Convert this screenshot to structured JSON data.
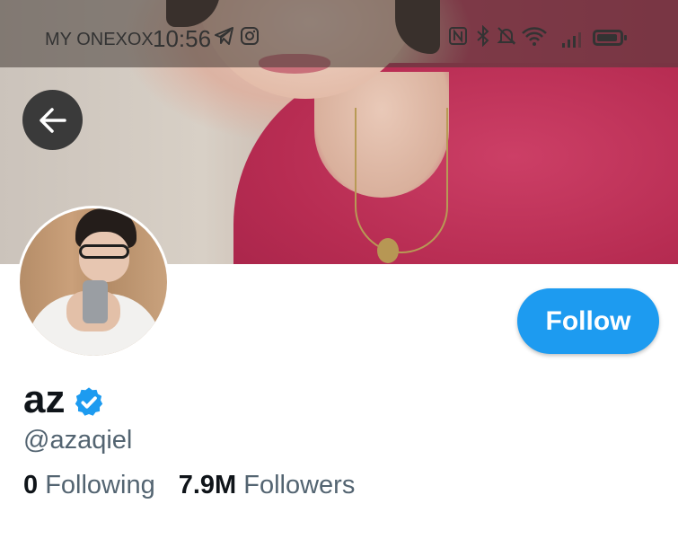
{
  "status_bar": {
    "carrier": "MY ONEXOX",
    "time": "10:56",
    "icons": [
      "telegram-icon",
      "instagram-icon",
      "nfc-icon",
      "bluetooth-icon",
      "mute-bell-icon",
      "wifi-icon",
      "signal-icon",
      "battery-icon"
    ]
  },
  "profile": {
    "display_name": "az",
    "handle": "@azaqiel",
    "verified": true,
    "following_count": "0",
    "following_label": "Following",
    "followers_count": "7.9M",
    "followers_label": "Followers"
  },
  "actions": {
    "follow_label": "Follow"
  },
  "colors": {
    "accent": "#1d9bf0",
    "text_primary": "#0f1419",
    "text_secondary": "#536471"
  }
}
